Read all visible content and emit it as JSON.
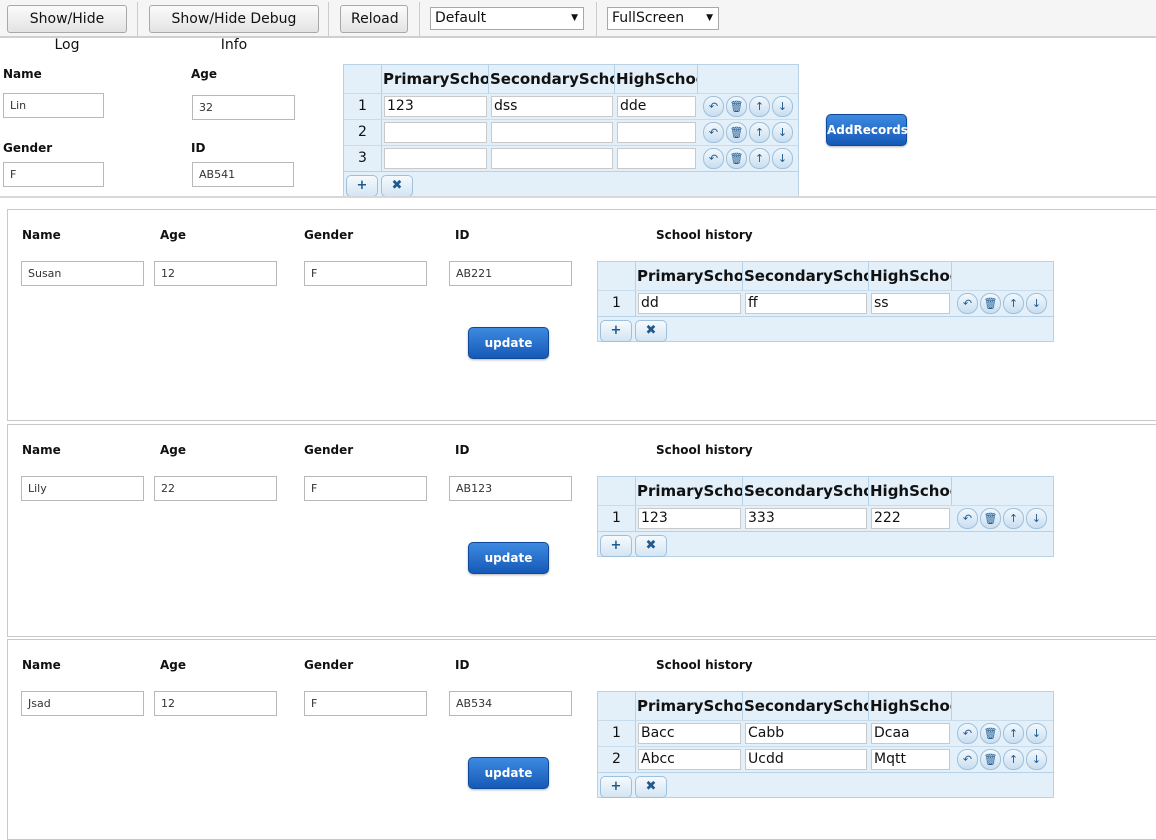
{
  "toolbar": {
    "show_hide_log": "Show/Hide Log",
    "show_hide_debug": "Show/Hide Debug Info",
    "reload": "Reload",
    "theme_select": "Default",
    "mode_select": "FullScreen"
  },
  "form": {
    "labels": {
      "name": "Name",
      "age": "Age",
      "gender": "Gender",
      "id": "ID"
    },
    "name": "Lin",
    "age": "32",
    "gender": "F",
    "id": "AB541",
    "add_button": "AddRecords",
    "columns": [
      "PrimarySchool",
      "SecondarySchool",
      "HighSchool"
    ],
    "rows": [
      {
        "num": "1",
        "cells": [
          "123",
          "dss",
          "dde"
        ]
      },
      {
        "num": "2",
        "cells": [
          "",
          "",
          ""
        ]
      },
      {
        "num": "3",
        "cells": [
          "",
          "",
          ""
        ]
      }
    ]
  },
  "record_labels": {
    "name": "Name",
    "age": "Age",
    "gender": "Gender",
    "id": "ID",
    "history": "School history",
    "update": "update"
  },
  "records": [
    {
      "name": "Susan",
      "age": "12",
      "gender": "F",
      "id": "AB221",
      "columns": [
        "PrimarySchool",
        "SecondarySchool",
        "HighSchool"
      ],
      "rows": [
        {
          "num": "1",
          "cells": [
            "dd",
            "ff",
            "ss"
          ]
        }
      ]
    },
    {
      "name": "Lily",
      "age": "22",
      "gender": "F",
      "id": "AB123",
      "columns": [
        "PrimarySchool",
        "SecondarySchool",
        "HighSchool"
      ],
      "rows": [
        {
          "num": "1",
          "cells": [
            "123",
            "333",
            "222"
          ]
        }
      ]
    },
    {
      "name": "Jsad",
      "age": "12",
      "gender": "F",
      "id": "AB534",
      "columns": [
        "PrimarySchool",
        "SecondarySchool",
        "HighSchool"
      ],
      "rows": [
        {
          "num": "1",
          "cells": [
            "Bacc",
            "Cabb",
            "Dcaa"
          ]
        },
        {
          "num": "2",
          "cells": [
            "Abcc",
            "Ucdd",
            "Mqtt"
          ]
        }
      ]
    }
  ],
  "icons": {
    "undo": "↶",
    "delete": "🗑",
    "up": "↑",
    "down": "↓",
    "add": "+",
    "remove": "✖",
    "accent": "#1a62c0",
    "grid_bg": "#e3eff9"
  }
}
